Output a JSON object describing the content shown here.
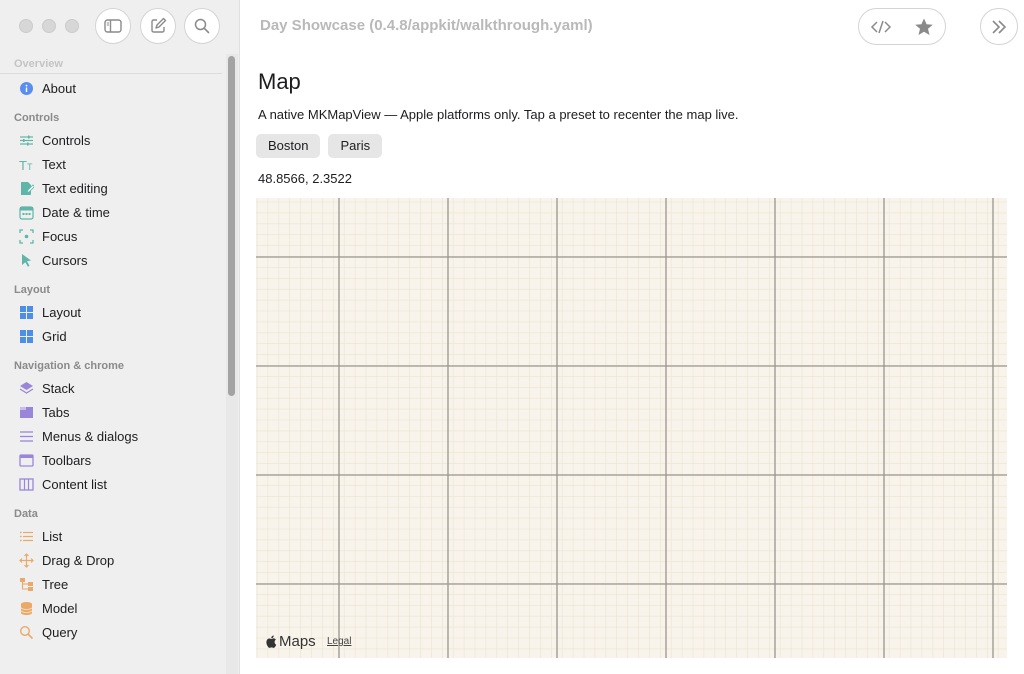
{
  "window": {
    "title": "Day Showcase (0.4.8/appkit/walkthrough.yaml)"
  },
  "toolbar": {
    "sidebar_toggle_icon": "sidebar-icon",
    "compose_icon": "compose-icon",
    "search_icon": "search-icon",
    "code_icon": "code-icon",
    "star_icon": "star-icon",
    "more_icon": "chevron-double-right-icon"
  },
  "sidebar": {
    "sections": [
      {
        "title": "Overview",
        "items": [
          {
            "label": "About",
            "icon": "info-icon",
            "color": "#5b8def"
          }
        ]
      },
      {
        "title": "Controls",
        "items": [
          {
            "label": "Controls",
            "icon": "sliders-icon",
            "color": "#5fb6a8"
          },
          {
            "label": "Text",
            "icon": "text-size-icon",
            "color": "#5fb6a8"
          },
          {
            "label": "Text editing",
            "icon": "edit-doc-icon",
            "color": "#5fb6a8"
          },
          {
            "label": "Date & time",
            "icon": "calendar-icon",
            "color": "#5fb6a8"
          },
          {
            "label": "Focus",
            "icon": "focus-icon",
            "color": "#5fb6a8"
          },
          {
            "label": "Cursors",
            "icon": "cursor-icon",
            "color": "#5fb6a8"
          }
        ]
      },
      {
        "title": "Layout",
        "items": [
          {
            "label": "Layout",
            "icon": "layout-grid-icon",
            "color": "#4d8ee8"
          },
          {
            "label": "Grid",
            "icon": "grid-icon",
            "color": "#4d8ee8"
          }
        ]
      },
      {
        "title": "Navigation & chrome",
        "items": [
          {
            "label": "Stack",
            "icon": "stack-icon",
            "color": "#9a86d9"
          },
          {
            "label": "Tabs",
            "icon": "tabs-icon",
            "color": "#9a86d9"
          },
          {
            "label": "Menus & dialogs",
            "icon": "menu-icon",
            "color": "#9a86d9"
          },
          {
            "label": "Toolbars",
            "icon": "window-icon",
            "color": "#9a86d9"
          },
          {
            "label": "Content list",
            "icon": "columns-icon",
            "color": "#9a86d9"
          }
        ]
      },
      {
        "title": "Data",
        "items": [
          {
            "label": "List",
            "icon": "list-icon",
            "color": "#e9a96a"
          },
          {
            "label": "Drag & Drop",
            "icon": "move-icon",
            "color": "#e9a96a"
          },
          {
            "label": "Tree",
            "icon": "tree-icon",
            "color": "#e9a96a"
          },
          {
            "label": "Model",
            "icon": "database-icon",
            "color": "#e9a96a"
          },
          {
            "label": "Query",
            "icon": "magnifier-icon",
            "color": "#e9a96a"
          }
        ]
      }
    ]
  },
  "main": {
    "title": "Map",
    "description": "A native MKMapView — Apple platforms only. Tap a preset to recenter the map live.",
    "presets": [
      "Boston",
      "Paris"
    ],
    "coordinates": "48.8566, 2.3522",
    "map": {
      "brand": "Maps",
      "legal": "Legal",
      "background_color": "#f8f4ec",
      "major_grid_color": "#9a958c",
      "minor_grid_color": "#ebe3d3"
    }
  }
}
